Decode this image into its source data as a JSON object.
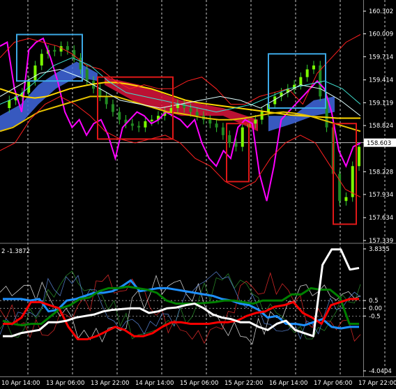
{
  "chart_data": [
    {
      "type": "candlestick",
      "pane": "main",
      "y_axis_labels": [
        "160.302",
        "160.009",
        "159.714",
        "159.414",
        "159.119",
        "158.824",
        "158.603",
        "158.228",
        "157.934",
        "157.634",
        "157.339"
      ],
      "ylim": [
        157.339,
        160.302
      ],
      "current_price": "158.603",
      "time_labels": [
        "10 Apr 14:00",
        "13 Apr 06:00",
        "13 Apr 22:00",
        "14 Apr 14:00",
        "15 Apr 06:00",
        "15 Apr 22:00",
        "16 Apr 14:00",
        "17 Apr 06:00",
        "17 Apr 22:00"
      ],
      "price_path": [
        159.05,
        159.15,
        159.2,
        159.25,
        159.4,
        159.6,
        159.75,
        159.8,
        159.78,
        159.85,
        159.8,
        159.7,
        159.55,
        159.4,
        159.3,
        159.2,
        159.1,
        159.0,
        158.9,
        158.85,
        158.82,
        158.8,
        158.88,
        158.9,
        158.95,
        159.0,
        159.05,
        159.1,
        159.05,
        159.0,
        158.95,
        158.9,
        158.85,
        158.8,
        158.7,
        158.6,
        158.55,
        158.8,
        158.85,
        158.9,
        159.0,
        159.1,
        159.2,
        159.25,
        159.3,
        159.35,
        159.45,
        159.55,
        159.6,
        159.2,
        158.8,
        158.2,
        157.85,
        157.9,
        158.3,
        158.55
      ],
      "series": [
        {
          "name": "",
          "color": "#ff00ff",
          "values": [
            159.85,
            159.9,
            159.3,
            159.0,
            159.8,
            159.9,
            159.95,
            159.7,
            159.4,
            159.0,
            158.8,
            158.9,
            158.7,
            158.85,
            158.9,
            158.7,
            158.4,
            158.8,
            158.9,
            159.0,
            158.95,
            158.85,
            158.9,
            159.0,
            158.95,
            158.9,
            158.8,
            158.9,
            158.6,
            158.4,
            158.3,
            158.5,
            158.4,
            158.8,
            158.9,
            158.85,
            158.2,
            157.85,
            158.3,
            158.9,
            159.0,
            159.1,
            159.2,
            159.3,
            159.4,
            159.3,
            159.0,
            158.5,
            158.3,
            158.55,
            158.6
          ]
        },
        {
          "name": "",
          "color": "#ffd700",
          "values": [
            159.3,
            159.25,
            159.2,
            159.18,
            159.2,
            159.25,
            159.3,
            159.33,
            159.36,
            159.38,
            159.38,
            159.36,
            159.33,
            159.3,
            159.25,
            159.2,
            159.15,
            159.12,
            159.1,
            159.08,
            159.06,
            159.04,
            159.02,
            159.0,
            158.98,
            158.96,
            158.95,
            158.94,
            158.93,
            158.92,
            158.92,
            158.92
          ]
        },
        {
          "name": "",
          "color": "#e6c200",
          "values": [
            158.75,
            158.8,
            158.9,
            159.0,
            159.05,
            159.1,
            159.15,
            159.2,
            159.2,
            159.2,
            159.15,
            159.1,
            159.05,
            159.0,
            158.98,
            158.95,
            158.92,
            158.9,
            158.9,
            158.92,
            158.95,
            158.98,
            159.0,
            158.98,
            158.95,
            158.9,
            158.85,
            158.8,
            158.75
          ]
        }
      ],
      "boxes": [
        {
          "color": "#3da9e6",
          "y_range": [
            159.4,
            160.0
          ]
        },
        {
          "color": "#e01818",
          "y_range": [
            158.65,
            159.45
          ]
        },
        {
          "color": "#e01818",
          "y_range": [
            158.1,
            158.85
          ]
        },
        {
          "color": "#3da9e6",
          "y_range": [
            159.05,
            159.75
          ]
        },
        {
          "color": "#e01818",
          "y_range": [
            157.55,
            158.85
          ]
        }
      ]
    },
    {
      "type": "line",
      "pane": "indicator",
      "header": "2 -1.3872",
      "y_axis_labels": [
        "3.8355",
        "0.5",
        "0.00",
        "-0.5",
        "-4.0404"
      ],
      "ylim": [
        -4.0404,
        3.8355
      ],
      "series": [
        {
          "name": "",
          "color": "#1e90ff",
          "values": [
            0.6,
            0.6,
            0.6,
            0.5,
            0.6,
            -0.2,
            -0.1,
            0.5,
            0.6,
            0.8,
            1.0,
            1.0,
            1.1,
            1.4,
            1.8,
            1.1,
            1.2,
            1.3,
            1.3,
            1.2,
            1.1,
            1.0,
            0.9,
            0.8,
            0.6,
            0.5,
            0.3,
            0.2,
            -0.1,
            -0.6,
            -0.5,
            -1.0,
            -1.0,
            -1.1,
            -0.9,
            -0.7,
            -1.2,
            -1.3,
            -1.2,
            -1.2
          ]
        },
        {
          "name": "",
          "color": "#008000",
          "values": [
            -0.8,
            -1.0,
            -1.1,
            -1.0,
            -1.0,
            -0.5,
            0.0,
            0.2,
            0.6,
            0.7,
            1.1,
            1.3,
            1.3,
            1.4,
            1.3,
            1.2,
            1.0,
            0.5,
            0.3,
            0.3,
            0.3,
            0.35,
            0.4,
            0.5,
            0.5,
            0.4,
            0.3,
            0.5,
            0.5,
            0.5,
            0.9,
            0.9,
            1.3,
            1.2,
            1.2,
            0.7,
            -1.0,
            -1.0
          ]
        },
        {
          "name": "",
          "color": "#ff0000",
          "values": [
            -1.0,
            -1.0,
            -0.6,
            0.4,
            0.4,
            0.2,
            0.0,
            -1.2,
            -2.0,
            -2.0,
            -1.8,
            -1.5,
            -1.2,
            -1.4,
            -1.8,
            -1.8,
            -1.6,
            -1.2,
            -0.9,
            -0.9,
            -1.0,
            -1.0,
            -1.0,
            -0.9,
            -0.9,
            -0.8,
            -0.5,
            -0.3,
            -0.2,
            0.1,
            0.2,
            0.4,
            -0.3,
            -0.6,
            -1.0,
            0.2,
            0.4,
            0.6,
            0.6
          ]
        },
        {
          "name": "",
          "color": "#ffffff",
          "values": [
            -1.8,
            -1.8,
            -1.6,
            -1.5,
            -1.4,
            -0.9,
            -0.9,
            -0.8,
            -0.6,
            -0.5,
            -0.4,
            -0.2,
            -0.1,
            -0.05,
            0.0,
            0.0,
            -0.3,
            -0.2,
            0.0,
            0.05,
            0.2,
            0.3,
            0.0,
            -0.4,
            -0.6,
            -0.7,
            -0.9,
            -0.9,
            -1.2,
            -1.4,
            -1.0,
            -0.8,
            -1.4,
            -1.6,
            -1.8,
            2.8,
            3.8,
            3.8,
            2.5,
            2.6
          ]
        }
      ]
    }
  ]
}
